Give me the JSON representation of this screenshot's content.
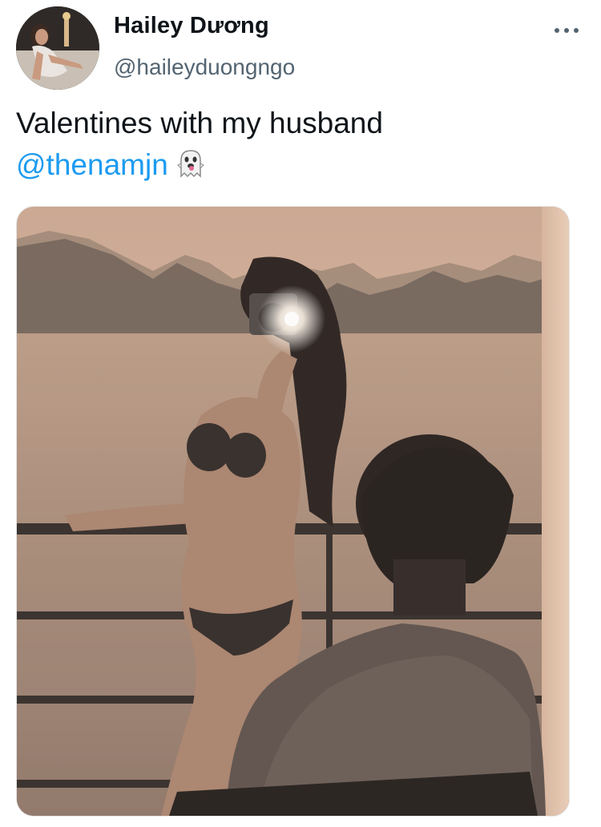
{
  "tweet": {
    "author": {
      "display_name": "Hailey Dương",
      "handle": "@haileyduongngo",
      "avatar_icon": "user-avatar-photo"
    },
    "more_icon": "more-horizontal-icon",
    "text": "Valentines with my husband",
    "mention": "@thenamjn",
    "emoji": "ghost-emoji",
    "media": {
      "type": "photo",
      "icon": "photo-media"
    }
  },
  "colors": {
    "text_primary": "#0f1419",
    "text_secondary": "#536471",
    "link": "#1d9bf0"
  }
}
